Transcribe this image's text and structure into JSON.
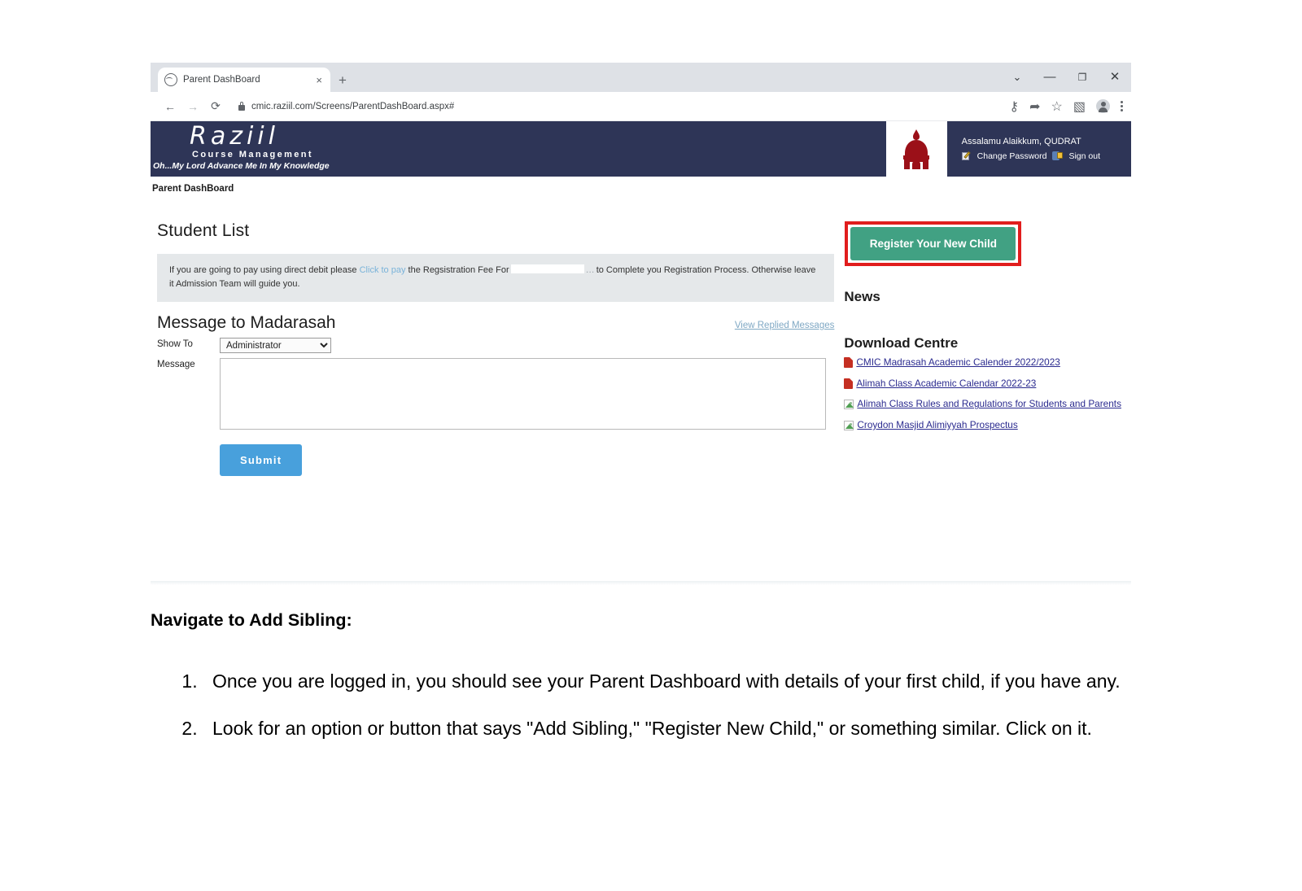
{
  "browser": {
    "tab_title": "Parent DashBoard",
    "tab_close": "×",
    "new_tab": "+",
    "window_minimize": "—",
    "window_maximize": "❐",
    "window_close": "✕",
    "window_expand": "⌄",
    "back": "←",
    "forward": "→",
    "reload": "⟳",
    "url": "cmic.raziil.com/Screens/ParentDashBoard.aspx#",
    "icon_key": "⚷",
    "icon_share": "➦",
    "icon_star": "☆",
    "icon_sidepanel": "▧"
  },
  "app": {
    "brand": {
      "logo_text": "Raziil",
      "subtitle": "Course Management",
      "tagline": "Oh...My Lord Advance Me In My Knowledge"
    },
    "user": {
      "greeting": "Assalamu Alaikkum, QUDRAT",
      "change_password": "Change Password",
      "sign_out": "Sign out"
    },
    "breadcrumb": "Parent DashBoard",
    "student_list": {
      "title": "Student List",
      "notice_before_link": "If you are going to pay using direct debit please ",
      "notice_link": "Click to pay",
      "notice_after_link": " the Regsistration Fee For",
      "notice_redacted_tail": "…",
      "notice_after_redact": "to Complete you Registration Process. Otherwise leave it Admission Team will guide you."
    },
    "message": {
      "title": "Message to Madarasah",
      "view_replied": "View Replied Messages",
      "show_to_label": "Show To",
      "show_to_value": "Administrator",
      "show_to_options": [
        "Administrator"
      ],
      "message_label": "Message",
      "message_value": "",
      "submit_label": "Submit"
    },
    "sidebar": {
      "register_button": "Register Your New Child",
      "news_title": "News",
      "download_title": "Download Centre",
      "downloads": [
        {
          "label": "CMIC Madrasah Academic Calender 2022/2023",
          "icon": "pdf-icon"
        },
        {
          "label": "Alimah Class Academic Calendar 2022-23",
          "icon": "pdf-icon"
        },
        {
          "label": "Alimah Class Rules and Regulations for Students and Parents",
          "icon": "broken-image-icon"
        },
        {
          "label": "Croydon Masjid Alimiyyah Prospectus",
          "icon": "broken-image-icon"
        }
      ]
    },
    "colors": {
      "header_navy": "#2e3557",
      "register_green": "#41a183",
      "highlight_red": "#e11d1d",
      "submit_blue": "#48a0dc",
      "notice_grey": "#e5e8ea",
      "link_blue": "#2b2b8f"
    }
  },
  "document": {
    "heading": "Navigate to Add Sibling:",
    "items": [
      "Once you are logged in, you should see your Parent Dashboard with details of your first child, if you have any.",
      "Look for an option or button that says \"Add Sibling,\" \"Register New Child,\" or something similar. Click on it."
    ]
  }
}
